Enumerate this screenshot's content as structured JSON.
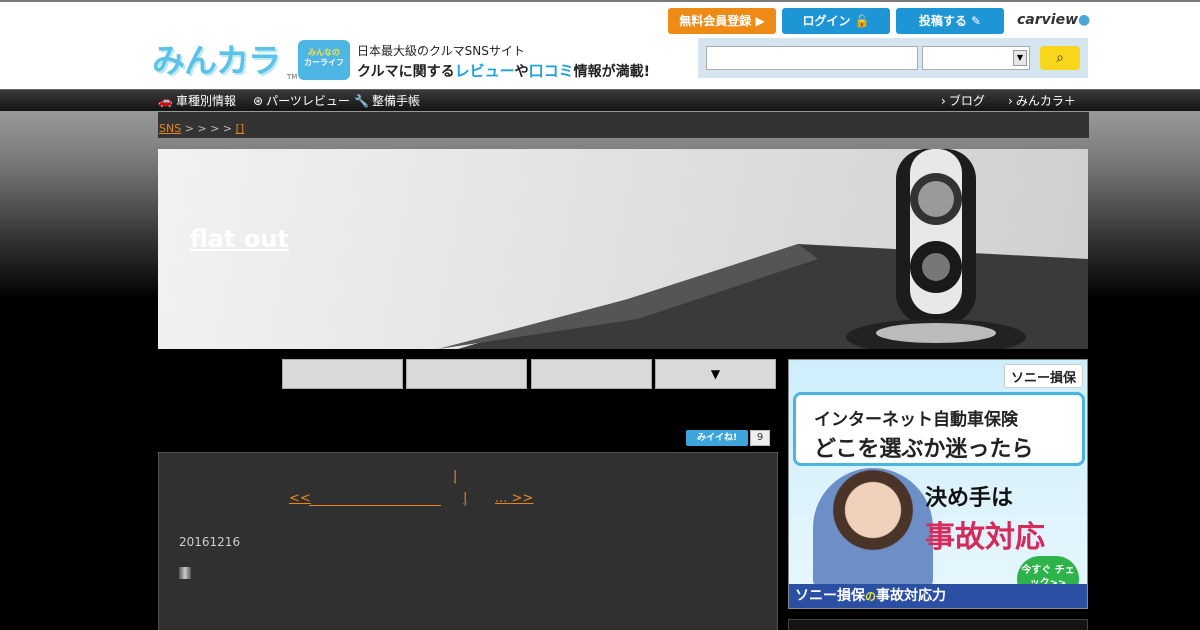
{
  "header": {
    "logo_text": "みんカラ",
    "tm": "TM",
    "carlife_badge_line1": "みんなの",
    "carlife_badge_line2": "カーライフ",
    "tagline_line1": "日本最大級のクルマSNSサイト",
    "tagline_pre": "クルマに関する",
    "tagline_review": "レビュー",
    "tagline_mid": "や",
    "tagline_kuchikomi": "口コミ",
    "tagline_post": "情報が満載!",
    "register_label": "無料会員登録 ▶",
    "login_label": "ログイン 🔓",
    "post_label": "投稿する ✎",
    "carview_label": "carview",
    "search": {
      "input_value": "",
      "select_value": "",
      "button_icon": "search-icon"
    }
  },
  "nav": {
    "left": [
      {
        "icon": "car-icon",
        "label": "車種別情報"
      },
      {
        "icon": "parts-icon",
        "label": "パーツレビュー"
      },
      {
        "icon": "wrench-icon",
        "label": "整備手帳"
      }
    ],
    "right": [
      {
        "label": "ブログ"
      },
      {
        "label": "みんカラ＋"
      }
    ]
  },
  "breadcrumb": {
    "first_link": "SNS",
    "separators": " > > > > ",
    "last_link": "[]"
  },
  "banner": {
    "title": "flat out"
  },
  "tabs": [
    {
      "label": ""
    },
    {
      "label": ""
    },
    {
      "label": ""
    },
    {
      "label": "▼"
    }
  ],
  "like": {
    "label": "みイイね!",
    "count": "9"
  },
  "content": {
    "top_link": "|",
    "prev_link": "<<",
    "center_link": "|",
    "next_link": "... >>",
    "date": "20161216"
  },
  "ad": {
    "brand": "ソニー損保",
    "line1": "インターネット自動車保険",
    "line2": "どこを選ぶか迷ったら",
    "line3": "決め手は",
    "line4": "事故対応",
    "cta": "今すぐ チェック>>",
    "footer_main": "ソニー損保",
    "footer_small": "の",
    "footer_end": "事故対応力"
  },
  "colors": {
    "accent_orange": "#e8861c",
    "brand_blue": "#1e95d4",
    "register_orange": "#f08a17",
    "search_yellow": "#f7d61c"
  }
}
